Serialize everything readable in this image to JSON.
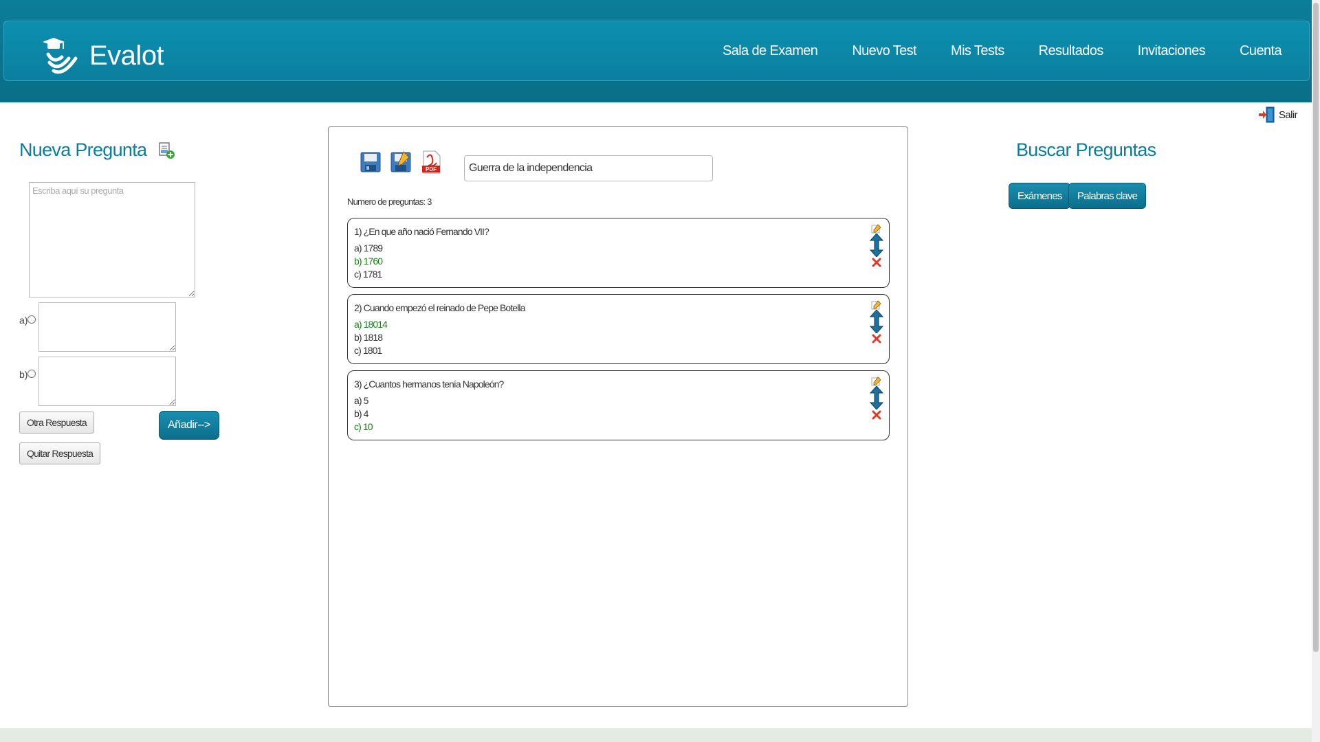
{
  "app": {
    "name": "Evalot"
  },
  "nav": {
    "items": [
      {
        "label": "Sala de Examen"
      },
      {
        "label": "Nuevo Test"
      },
      {
        "label": "Mis Tests"
      },
      {
        "label": "Resultados"
      },
      {
        "label": "Invitaciones"
      },
      {
        "label": "Cuenta"
      }
    ]
  },
  "logout": {
    "label": "Salir",
    "icon": "exit-door-icon"
  },
  "new_question": {
    "title": "Nueva Pregunta",
    "add_icon": "add-document-icon",
    "placeholder": "Escriba aquí su pregunta",
    "answers": [
      {
        "label": "a)",
        "value": ""
      },
      {
        "label": "b)",
        "value": ""
      }
    ],
    "other_answer_label": "Otra Respuesta",
    "remove_answer_label": "Quitar Respuesta",
    "add_label": "Añadir-->"
  },
  "test": {
    "title_value": "Guerra de la independencia",
    "toolbar": [
      "save-icon",
      "save-edit-icon",
      "pdf-icon"
    ],
    "pdf_badge": "PDF",
    "count_text": "Numero de preguntas: 3",
    "questions": [
      {
        "text": "1) ¿En que año nació Fernando VII?",
        "answers": [
          {
            "text": "a) 1789",
            "correct": false
          },
          {
            "text": "b) 1760",
            "correct": true
          },
          {
            "text": "c) 1781",
            "correct": false
          }
        ]
      },
      {
        "text": "2) Cuando empezó el reinado de Pepe Botella",
        "answers": [
          {
            "text": "a) 18014",
            "correct": true
          },
          {
            "text": "b) 1818",
            "correct": false
          },
          {
            "text": "c) 1801",
            "correct": false
          }
        ]
      },
      {
        "text": "3) ¿Cuantos hermanos tenía Napoleón?",
        "answers": [
          {
            "text": "a) 5",
            "correct": false
          },
          {
            "text": "b) 4",
            "correct": false
          },
          {
            "text": "c) 10",
            "correct": true
          }
        ]
      }
    ]
  },
  "search": {
    "title": "Buscar Preguntas",
    "exams_label": "Exámenes",
    "keywords_label": "Palabras clave"
  },
  "colors": {
    "brand": "#0b7d99",
    "correct": "#1a7a1a",
    "delete": "#e03a2a"
  }
}
